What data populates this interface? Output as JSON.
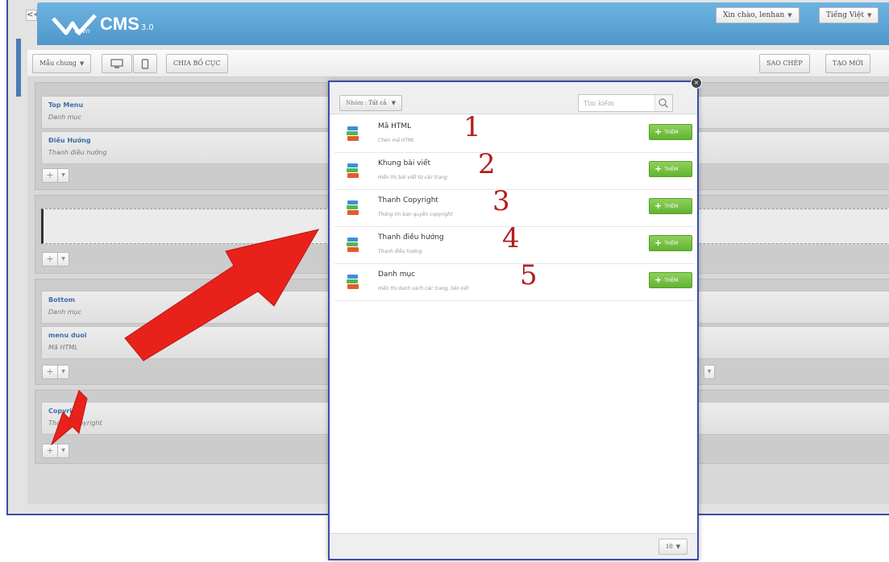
{
  "header": {
    "brand": "CMS",
    "version": "3.0",
    "logo_sub": "vnvn",
    "greeting": "Xin chào, lenhan",
    "language": "Tiếng Việt"
  },
  "collapse": "<<",
  "toolbar": {
    "template_select": "Mẫu chung",
    "split_layout": "CHIA BỐ CỤC",
    "copy": "SAO CHÉP",
    "create_new": "TẠO MỚI"
  },
  "layout": {
    "modules": [
      {
        "title": "Top Menu",
        "subtitle": "Danh mục"
      },
      {
        "title": "Điều Hướng",
        "subtitle": "Thanh điều hướng"
      },
      {
        "title": "Bottom",
        "subtitle": "Danh mục"
      },
      {
        "title": "menu duoi",
        "subtitle": "Mã HTML"
      },
      {
        "title": "Copyright",
        "subtitle": "Thanh Copyright"
      }
    ],
    "add_symbol": "+",
    "dropdown_symbol": "▼"
  },
  "modal": {
    "group_label": "Nhóm :",
    "group_value": "Tất cả",
    "search_placeholder": "Tìm kiếm",
    "close": "×",
    "add_label": "THÊM",
    "page_size": "10",
    "widgets": [
      {
        "name": "Mã HTML",
        "desc": "Chèn mã HTML",
        "number": "1"
      },
      {
        "name": "Khung bài viết",
        "desc": "Hiển thị bài viết từ các trang",
        "number": "2"
      },
      {
        "name": "Thanh Copyright",
        "desc": "Thông tin bản quyền copyright",
        "number": "3"
      },
      {
        "name": "Thanh điều hướng",
        "desc": "Thanh điều hướng",
        "number": "4"
      },
      {
        "name": "Danh mục",
        "desc": "Hiển thị danh sách các trang, liên kết",
        "number": "5"
      }
    ]
  },
  "colors": {
    "header_blue": "#5fa9d8",
    "add_green": "#62b431",
    "annotation_red": "#b71c1c",
    "arrow_red": "#e8211b",
    "frame_blue": "#3a4fa8"
  },
  "icons": [
    "desktop-icon",
    "mobile-icon",
    "search-icon",
    "widget-stack-icon",
    "plus-icon",
    "chevron-down-icon",
    "close-icon"
  ]
}
